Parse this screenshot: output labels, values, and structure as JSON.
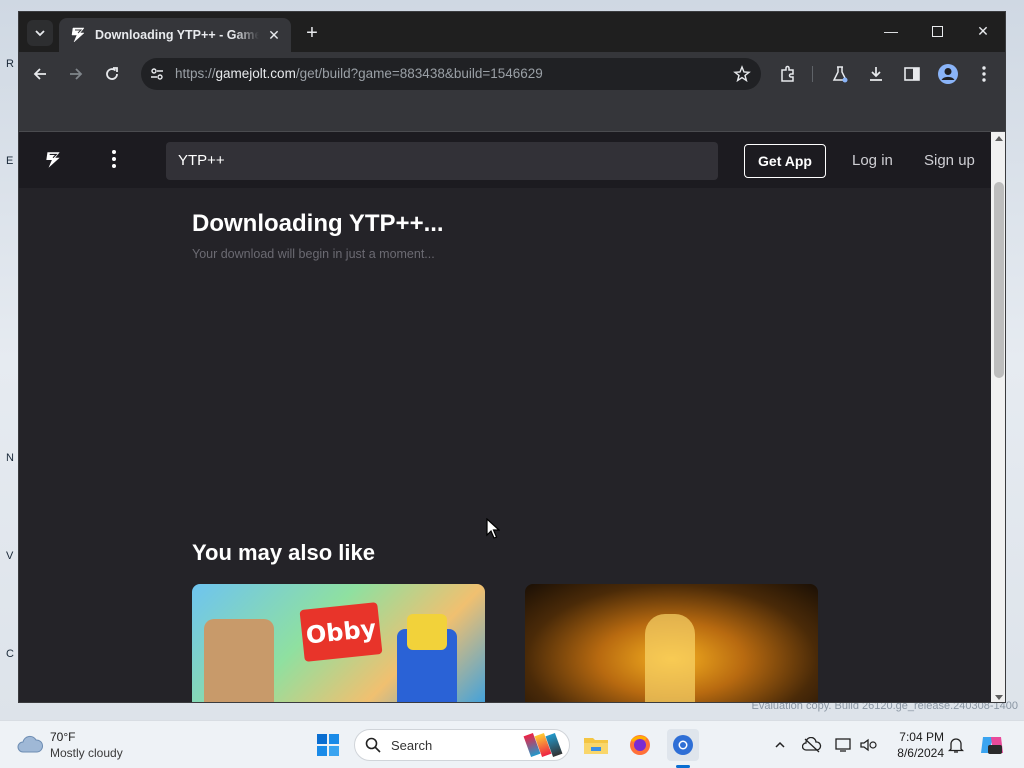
{
  "browser": {
    "tab_title": "Downloading YTP++ - Game Jolt",
    "url_scheme": "https://",
    "url_host": "gamejolt.com",
    "url_path": "/get/build?game=883438&build=1546629"
  },
  "site": {
    "search_value": "YTP++",
    "get_app_label": "Get App",
    "login_label": "Log in",
    "signup_label": "Sign up"
  },
  "main": {
    "download_title": "Downloading YTP++...",
    "download_subtitle": "Your download will begin in just a moment...",
    "also_like_title": "You may also like",
    "cards": [
      {
        "image_text": "Obby"
      },
      {
        "image_text": ""
      }
    ]
  },
  "taskbar": {
    "weather_temp": "70°F",
    "weather_desc": "Mostly cloudy",
    "search_label": "Search",
    "time": "7:04 PM",
    "date": "8/6/2024"
  },
  "desktop": {
    "watermark_line1": "Evaluation copy.",
    "watermark_line2": "Build 26120.ge_release.240308-1400"
  },
  "colors": {
    "page_bg": "#242328",
    "header_bg": "#1c1b20",
    "chrome_bg": "#35363a"
  }
}
